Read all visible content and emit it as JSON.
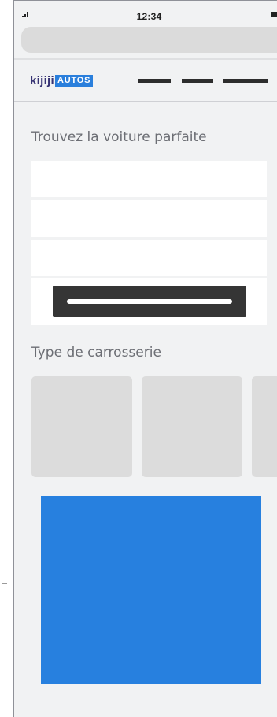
{
  "status_bar": {
    "time": "12:34",
    "signal_icon": "signal-strength-icon",
    "battery_icon": "battery-icon"
  },
  "browser": {
    "url_bar": ""
  },
  "header": {
    "logo_word": "kijiji",
    "logo_badge": "AUTOS",
    "menu_icon": "hamburger-menu-icon"
  },
  "search": {
    "title": "Trouvez la voiture parfaite",
    "fields": [
      "",
      "",
      ""
    ],
    "button_label": ""
  },
  "body_types": {
    "title": "Type de carrosserie",
    "tiles": [
      "",
      "",
      ""
    ]
  },
  "colors": {
    "brand_navy": "#373373",
    "brand_blue": "#2a7fdc",
    "ad_blue": "#2780df",
    "button_dark": "#353535",
    "page_bg": "#f1f2f3"
  }
}
